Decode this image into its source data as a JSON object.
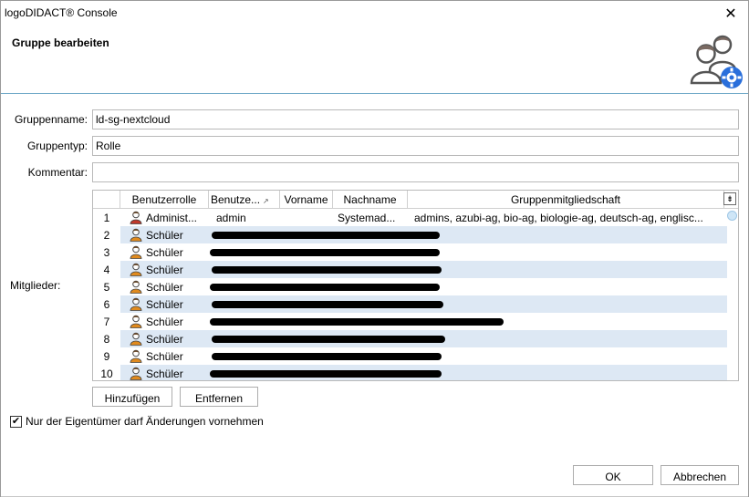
{
  "window": {
    "title": "logoDIDACT® Console",
    "close_glyph": "✕"
  },
  "header": {
    "heading": "Gruppe bearbeiten",
    "icon": "group-settings-icon"
  },
  "form": {
    "groupname_label": "Gruppenname:",
    "groupname_value": "ld-sg-nextcloud",
    "grouptype_label": "Gruppentyp:",
    "grouptype_value": "Rolle",
    "comment_label": "Kommentar:",
    "comment_value": ""
  },
  "members": {
    "label": "Mitglieder:",
    "columns": {
      "role": "Benutzerrolle",
      "username": "Benutze...",
      "firstname": "Vorname",
      "lastname": "Nachname",
      "memberships": "Gruppenmitgliedschaft"
    },
    "rows": [
      {
        "num": "1",
        "role": "Administ...",
        "username": "admin",
        "firstname": "",
        "lastname": "Systemad...",
        "memberships": "admins, azubi-ag, bio-ag, biologie-ag, deutsch-ag, englisc...",
        "icon_color": "#c0392b"
      },
      {
        "num": "2",
        "role": "Schüler",
        "username": "",
        "firstname": "",
        "lastname": "",
        "memberships": "",
        "icon_color": "#e08a1e"
      },
      {
        "num": "3",
        "role": "Schüler",
        "username": "",
        "firstname": "",
        "lastname": "",
        "memberships": "",
        "icon_color": "#e08a1e"
      },
      {
        "num": "4",
        "role": "Schüler",
        "username": "",
        "firstname": "",
        "lastname": "",
        "memberships": "",
        "icon_color": "#e08a1e"
      },
      {
        "num": "5",
        "role": "Schüler",
        "username": "",
        "firstname": "",
        "lastname": "",
        "memberships": "",
        "icon_color": "#e08a1e"
      },
      {
        "num": "6",
        "role": "Schüler",
        "username": "",
        "firstname": "",
        "lastname": "",
        "memberships": "",
        "icon_color": "#e08a1e"
      },
      {
        "num": "7",
        "role": "Schüler",
        "username": "",
        "firstname": "",
        "lastname": "",
        "memberships": "",
        "icon_color": "#e08a1e"
      },
      {
        "num": "8",
        "role": "Schüler",
        "username": "",
        "firstname": "",
        "lastname": "",
        "memberships": "",
        "icon_color": "#e08a1e"
      },
      {
        "num": "9",
        "role": "Schüler",
        "username": "",
        "firstname": "",
        "lastname": "",
        "memberships": "",
        "icon_color": "#e08a1e"
      },
      {
        "num": "10",
        "role": "Schüler",
        "username": "",
        "firstname": "",
        "lastname": "",
        "memberships": "",
        "icon_color": "#e08a1e"
      }
    ],
    "add_label": "Hinzufügen",
    "remove_label": "Entfernen"
  },
  "owner_only": {
    "label": "Nur der Eigentümer darf Änderungen vornehmen",
    "checked": true
  },
  "footer": {
    "ok_label": "OK",
    "cancel_label": "Abbrechen"
  },
  "colors": {
    "accent": "#6fa8c7",
    "row_alt": "#dde8f4",
    "gear": "#2a6fdb"
  }
}
